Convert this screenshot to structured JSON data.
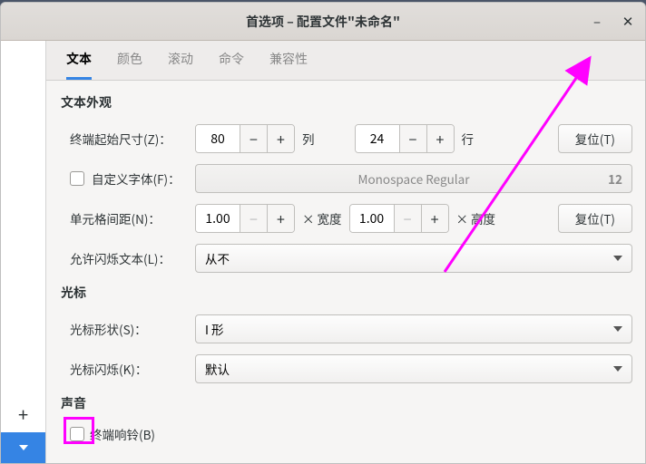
{
  "title": "首选项 – 配置文件\"未命名\"",
  "tabs": {
    "t0": "文本",
    "t1": "颜色",
    "t2": "滚动",
    "t3": "命令",
    "t4": "兼容性"
  },
  "sections": {
    "appearance": "文本外观",
    "cursor": "光标",
    "sound": "声音"
  },
  "labels": {
    "initial_size": "终端起始尺寸(Z)：",
    "custom_font": "自定义字体(F)：",
    "cell_spacing": "单元格间距(N)：",
    "allow_blink": "允许闪烁文本(L)：",
    "cursor_shape": "光标形状(S)：",
    "cursor_blink": "光标闪烁(K)：",
    "terminal_bell": "终端响铃(B)"
  },
  "values": {
    "cols": "80",
    "rows": "24",
    "cols_unit": "列",
    "rows_unit": "行",
    "reset": "复位(T)",
    "font_name": "Monospace Regular",
    "font_size": "12",
    "cell_w": "1.00",
    "cell_h": "1.00",
    "times_width": "× 宽度",
    "times_height": "× 高度",
    "blink_mode": "从不",
    "cursor_shape_val": "I 形",
    "cursor_blink_val": "默认"
  }
}
